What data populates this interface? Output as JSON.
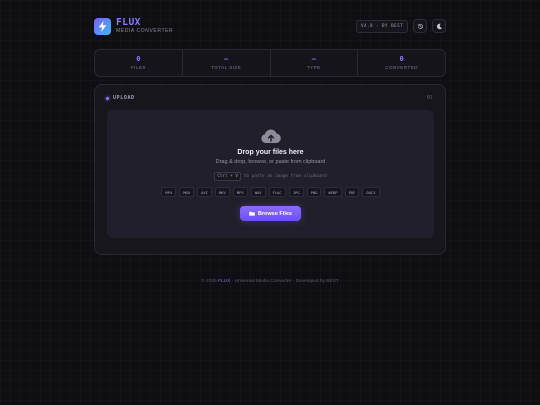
{
  "header": {
    "brand_name": "FLUX",
    "brand_sub": "MEDIA CONVERTER",
    "version": "V4.0 · BY BEST",
    "history_icon": "history-icon",
    "theme_icon": "moon-icon"
  },
  "stats": [
    {
      "value": "0",
      "label": "FILES"
    },
    {
      "value": "—",
      "label": "TOTAL SIZE"
    },
    {
      "value": "—",
      "label": "TYPE"
    },
    {
      "value": "0",
      "label": "CONVERTED"
    }
  ],
  "upload": {
    "title": "UPLOAD",
    "count": "0l",
    "drop_title": "Drop your files here",
    "drop_sub": "Drag & drop, browse, or paste from clipboard",
    "paste_key": "Ctrl + V",
    "paste_hint": "to paste an image from clipboard",
    "formats": [
      "MP4",
      "MOV",
      "AVI",
      "MKV",
      "MP3",
      "WAV",
      "FLAC",
      "JPG",
      "PNG",
      "WEBP",
      "PDF",
      "DOCX"
    ],
    "browse_label": "Browse Files"
  },
  "footer": {
    "prefix": "© 2025",
    "brand": "FLUX",
    "rest": "· Universal Media Converter · Developed by BEST"
  },
  "colors": {
    "accent": "#8b7bff",
    "background": "#0f0e13",
    "panel": "#17161d"
  }
}
